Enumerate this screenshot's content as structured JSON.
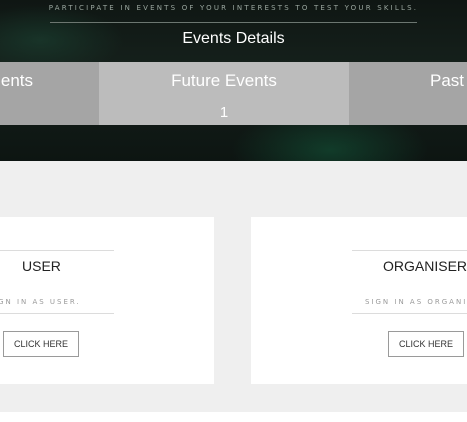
{
  "hero": {
    "tagline": "Participate in events of your interests to test your skills.",
    "title": "Events Details"
  },
  "tabs": [
    {
      "label": "ents"
    },
    {
      "label": "Future Events",
      "count": "1"
    },
    {
      "label": "Past"
    }
  ],
  "cards": [
    {
      "title": "USER",
      "subtitle": "ign in as user.",
      "button": "CLICK HERE"
    },
    {
      "title": "ORGANISER",
      "subtitle": "Sign in as organis",
      "button": "CLICK HERE"
    }
  ],
  "colors": {
    "hero_bg": "#15201b",
    "tab_active": "#bcbcbc",
    "tab_inactive": "#a5a5a5",
    "content_bg": "#efefef"
  }
}
